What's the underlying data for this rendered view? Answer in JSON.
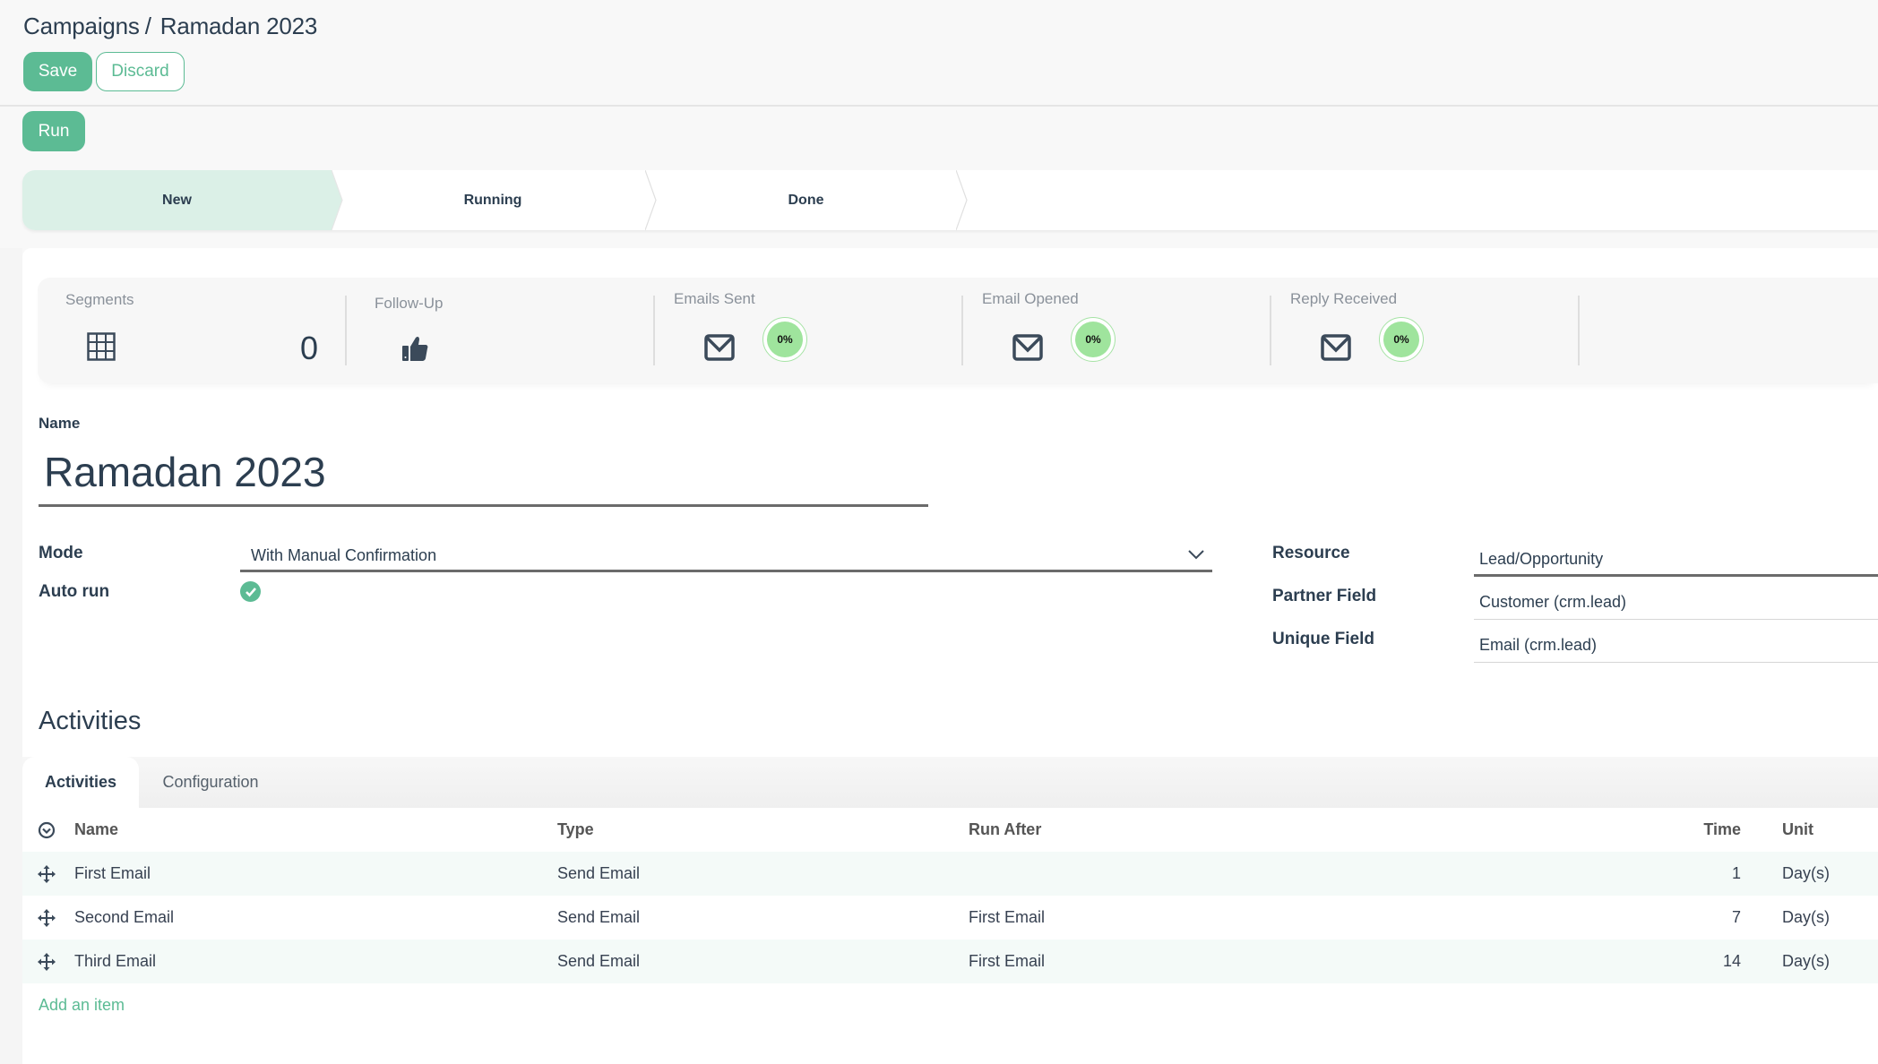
{
  "breadcrumb": {
    "parent": "Campaigns",
    "separator": "/",
    "current": "Ramadan 2023"
  },
  "toolbar": {
    "save_label": "Save",
    "discard_label": "Discard",
    "run_label": "Run"
  },
  "statusbar": {
    "stages": [
      {
        "label": "New",
        "active": true
      },
      {
        "label": "Running",
        "active": false
      },
      {
        "label": "Done",
        "active": false
      }
    ]
  },
  "stats": [
    {
      "label": "Segments",
      "icon": "table-grid-icon",
      "value": "0"
    },
    {
      "label": "Follow-Up",
      "icon": "thumbs-up-icon"
    },
    {
      "label": "Emails Sent",
      "icon": "envelope-icon",
      "percent": "0%"
    },
    {
      "label": "Email Opened",
      "icon": "envelope-icon",
      "percent": "0%"
    },
    {
      "label": "Reply Received",
      "icon": "envelope-icon",
      "percent": "0%"
    }
  ],
  "form": {
    "name_label": "Name",
    "name_value": "Ramadan 2023",
    "mode_label": "Mode",
    "mode_value": "With Manual Confirmation",
    "auto_run_label": "Auto run",
    "auto_run_checked": true,
    "resource_label": "Resource",
    "resource_value": "Lead/Opportunity",
    "partner_field_label": "Partner Field",
    "partner_field_value": "Customer (crm.lead)",
    "unique_field_label": "Unique Field",
    "unique_field_value": "Email (crm.lead)"
  },
  "activities": {
    "heading": "Activities",
    "tabs": [
      {
        "label": "Activities",
        "active": true
      },
      {
        "label": "Configuration",
        "active": false
      }
    ],
    "columns": {
      "name": "Name",
      "type": "Type",
      "run_after": "Run After",
      "time": "Time",
      "unit": "Unit"
    },
    "rows": [
      {
        "name": "First Email",
        "type": "Send Email",
        "run_after": "",
        "time": "1",
        "unit": "Day(s)"
      },
      {
        "name": "Second Email",
        "type": "Send Email",
        "run_after": "First Email",
        "time": "7",
        "unit": "Day(s)"
      },
      {
        "name": "Third Email",
        "type": "Send Email",
        "run_after": "First Email",
        "time": "14",
        "unit": "Day(s)"
      }
    ],
    "add_item_label": "Add an item"
  },
  "colors": {
    "primary": "#5cbb94",
    "stage_active_bg": "#dbf0e7",
    "pie_fill": "#9fe49d",
    "text": "#2c3e50"
  }
}
